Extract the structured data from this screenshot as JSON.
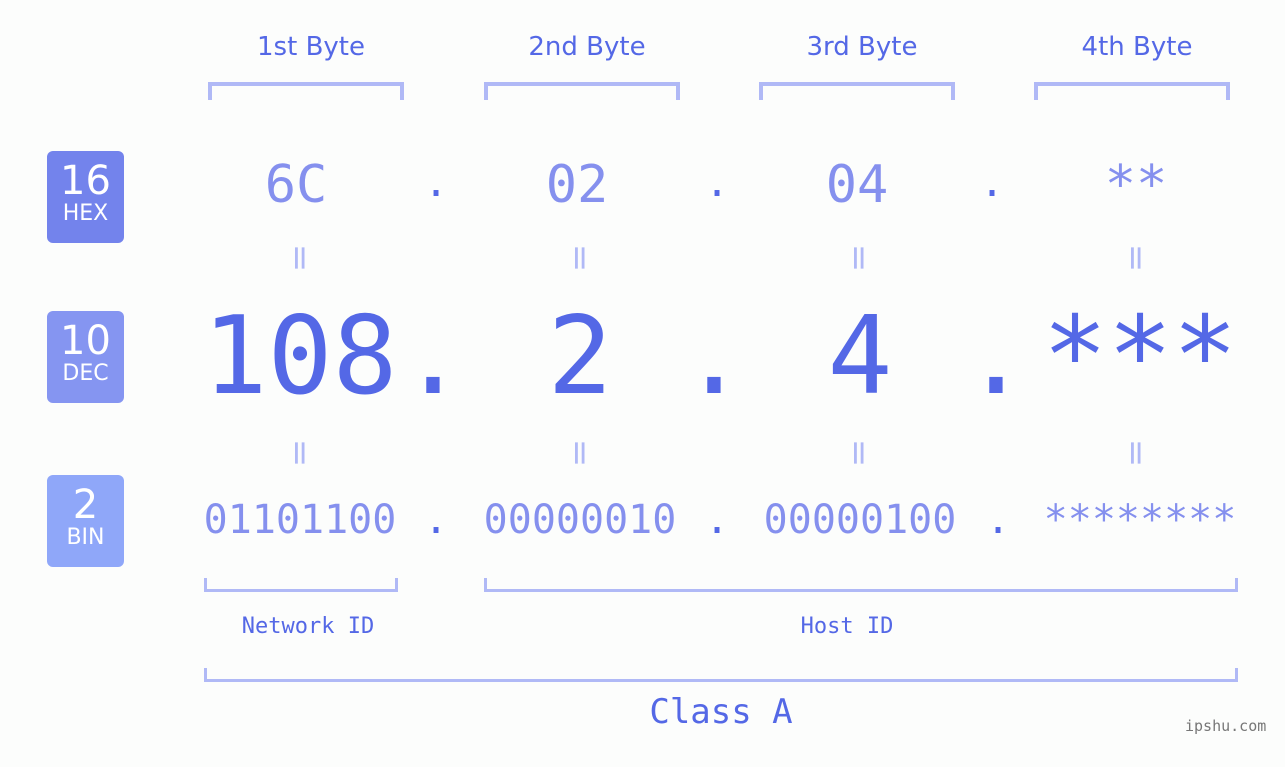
{
  "bytes": [
    {
      "header": "1st Byte",
      "hex": "6C",
      "dec": "108",
      "bin": "01101100"
    },
    {
      "header": "2nd Byte",
      "hex": "02",
      "dec": "2",
      "bin": "00000010"
    },
    {
      "header": "3rd Byte",
      "hex": "04",
      "dec": "4",
      "bin": "00000100"
    },
    {
      "header": "4th Byte",
      "hex": "**",
      "dec": "***",
      "bin": "********"
    }
  ],
  "separator": ".",
  "equals": "=",
  "badges": {
    "hex": {
      "num": "16",
      "label": "HEX",
      "color": "#7383ec"
    },
    "dec": {
      "num": "10",
      "label": "DEC",
      "color": "#8595f1"
    },
    "bin": {
      "num": "2",
      "label": "BIN",
      "color": "#8fa7f9"
    }
  },
  "labels": {
    "network_id": "Network ID",
    "host_id": "Host ID",
    "class": "Class A"
  },
  "watermark": "ipshu.com",
  "colors": {
    "primary": "#5468e6",
    "secondary": "#8590ee",
    "bracket": "#b0b9f6",
    "background": "#fcfdfc"
  }
}
